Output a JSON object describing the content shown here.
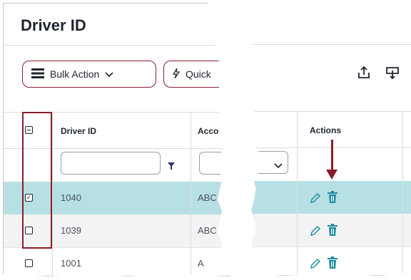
{
  "header": {
    "title": "Driver ID"
  },
  "toolbar": {
    "bulk_action_label": "Bulk Action",
    "quick_label": "Quick"
  },
  "grid": {
    "columns": {
      "driver_id": "Driver ID",
      "account": "Acco",
      "actions": "Actions"
    },
    "rows": [
      {
        "driver_id": "1040",
        "account": "ABC",
        "checked": true
      },
      {
        "driver_id": "1039",
        "account": "ABC",
        "checked": false
      },
      {
        "driver_id": "1001",
        "account": "A",
        "checked": false
      }
    ]
  },
  "icons": {
    "bulk": "list-icon",
    "chevron": "chevron-down-icon",
    "quick": "lightning-icon",
    "export": "export-icon",
    "import": "import-icon",
    "edit": "pencil-icon",
    "delete": "trash-icon",
    "filter": "filter-icon"
  },
  "colors": {
    "accent": "#8a1c2b",
    "selected_row": "#b7e0e4",
    "action_icon": "#1a8aa0"
  }
}
